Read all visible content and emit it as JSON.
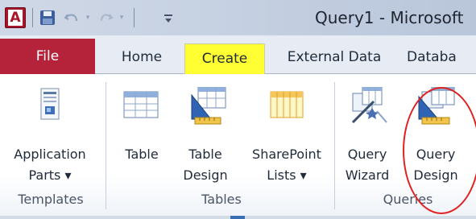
{
  "window": {
    "title": "Query1 - Microsoft",
    "app_icon_letter": "A"
  },
  "quick_access": {
    "save_icon": "save-icon",
    "undo_icon": "undo-icon",
    "redo_icon": "redo-icon",
    "dropdown_glyph": "▾"
  },
  "tabs": [
    {
      "label": "File"
    },
    {
      "label": "Home"
    },
    {
      "label": "Create",
      "highlight": "#ffff33"
    },
    {
      "label": "External Data"
    },
    {
      "label": "Databa"
    }
  ],
  "groups": {
    "templates": {
      "label": "Templates",
      "buttons": [
        {
          "line1": "Application",
          "line2": "Parts ▾",
          "icon": "application-parts-icon"
        }
      ]
    },
    "tables": {
      "label": "Tables",
      "buttons": [
        {
          "line1": "Table",
          "line2": "",
          "icon": "table-icon"
        },
        {
          "line1": "Table",
          "line2": "Design",
          "icon": "table-design-icon"
        },
        {
          "line1": "SharePoint",
          "line2": "Lists ▾",
          "icon": "sharepoint-lists-icon"
        }
      ]
    },
    "queries": {
      "label": "Queries",
      "buttons": [
        {
          "line1": "Query",
          "line2": "Wizard",
          "icon": "query-wizard-icon"
        },
        {
          "line1": "Query",
          "line2": "Design",
          "icon": "query-design-icon"
        }
      ]
    }
  },
  "colors": {
    "file_tab": "#b5233a",
    "create_highlight": "#ffff33",
    "annotation_circle": "#e12020"
  }
}
